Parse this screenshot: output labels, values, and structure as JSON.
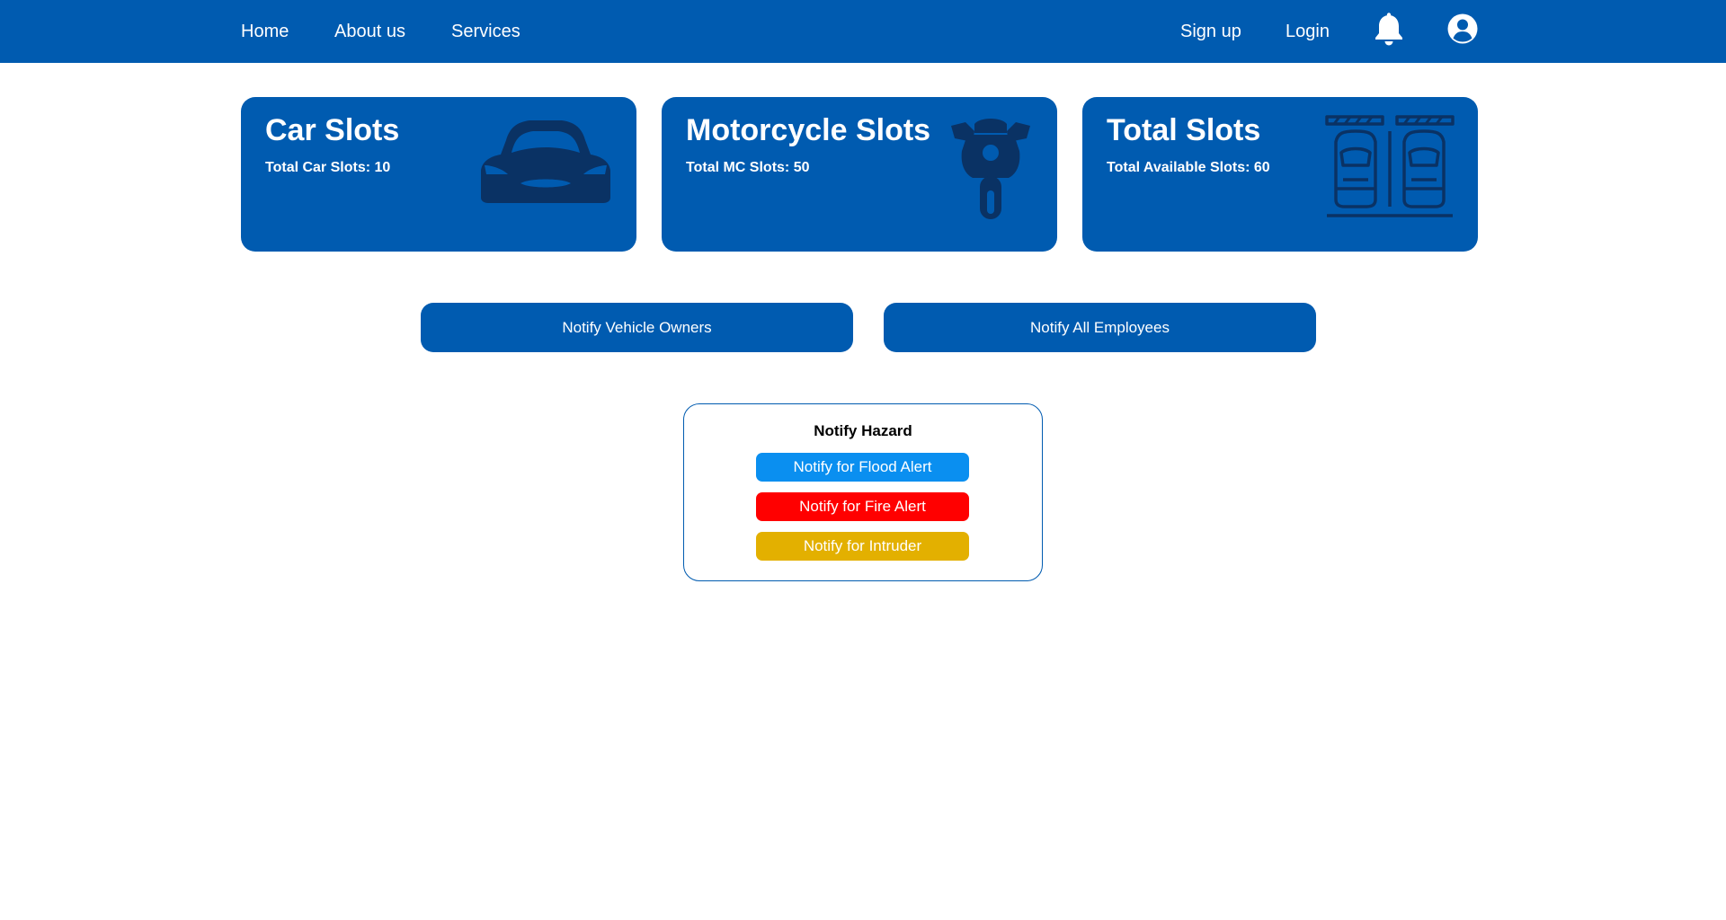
{
  "nav": {
    "home": "Home",
    "about": "About us",
    "services": "Services",
    "signup": "Sign up",
    "login": "Login",
    "icons": [
      "bell-icon",
      "user-circle-icon"
    ]
  },
  "cards": {
    "car": {
      "title": "Car Slots",
      "subtitle": "Total Car Slots: 10",
      "icon": "car-icon"
    },
    "motorcycle": {
      "title": "Motorcycle Slots",
      "subtitle": "Total MC Slots: 50",
      "icon": "motorcycle-icon"
    },
    "total": {
      "title": "Total Slots",
      "subtitle": "Total Available Slots: 60",
      "icon": "parking-lot-icon"
    }
  },
  "actions": {
    "notify_owners": "Notify Vehicle Owners",
    "notify_employees": "Notify All Employees"
  },
  "hazard": {
    "title": "Notify Hazard",
    "flood": "Notify for Flood Alert",
    "fire": "Notify for Fire Alert",
    "intruder": "Notify for Intruder"
  },
  "colors": {
    "primary": "#005bb0",
    "icon_dark": "#0a3264",
    "flood": "#0a8ff0",
    "fire": "#ff0000",
    "intruder": "#e3b000"
  }
}
